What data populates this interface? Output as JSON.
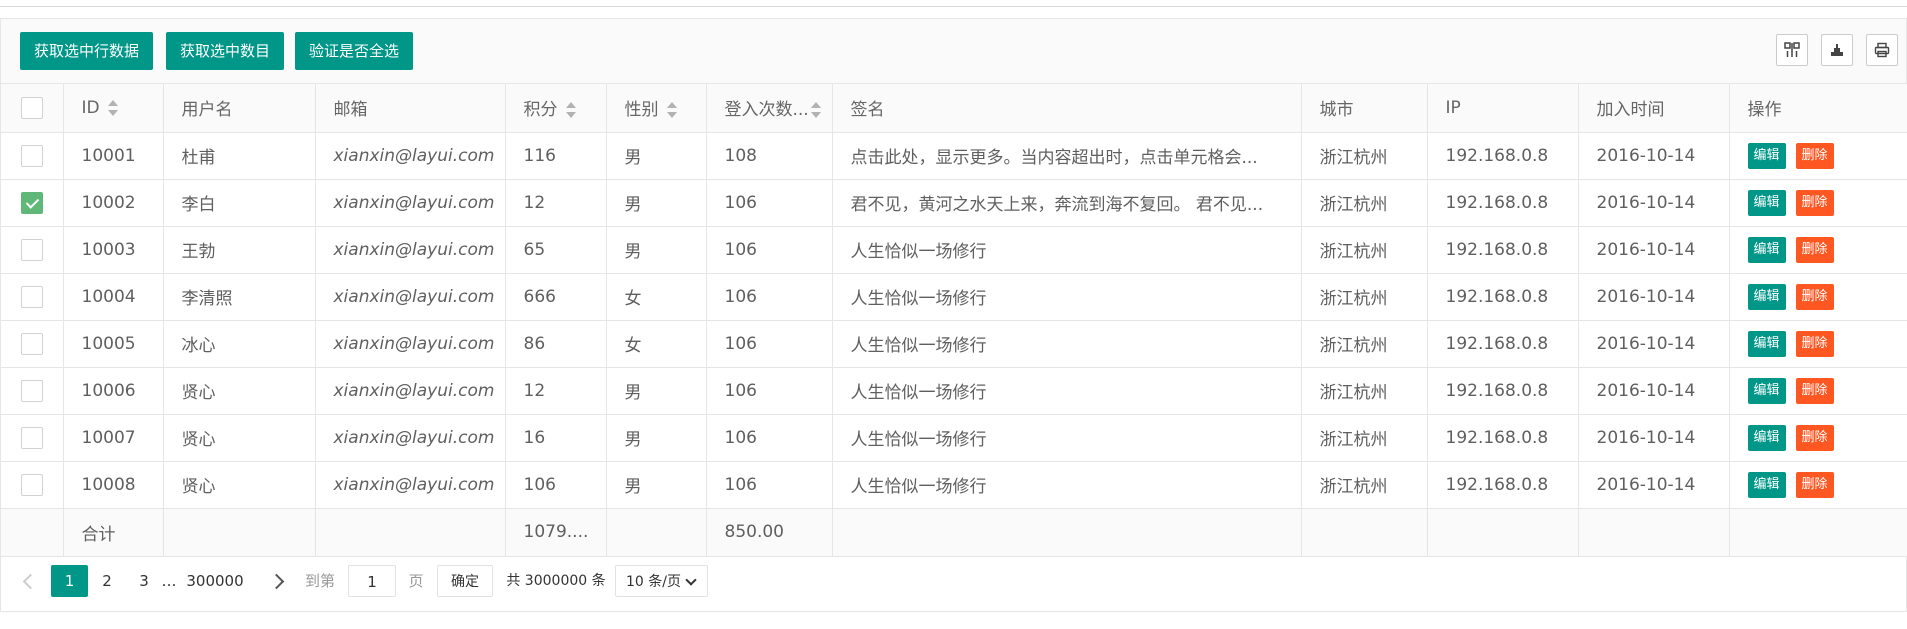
{
  "toolbar": {
    "buttons": [
      "获取选中行数据",
      "获取选中数目",
      "验证是否全选"
    ],
    "icons": [
      "columns-icon",
      "export-icon",
      "print-icon"
    ]
  },
  "table": {
    "headers": {
      "id": "ID",
      "username": "用户名",
      "email": "邮箱",
      "score": "积分",
      "sex": "性别",
      "logins": "登入次数...",
      "sign": "签名",
      "city": "城市",
      "ip": "IP",
      "joined": "加入时间",
      "actions": "操作"
    },
    "rows": [
      {
        "checked": false,
        "id": "10001",
        "username": "杜甫",
        "email": "xianxin@layui.com",
        "score": "116",
        "sex": "男",
        "logins": "108",
        "sign": "点击此处，显示更多。当内容超出时，点击单元格会...",
        "city": "浙江杭州",
        "ip": "192.168.0.8",
        "joined": "2016-10-14"
      },
      {
        "checked": true,
        "id": "10002",
        "username": "李白",
        "email": "xianxin@layui.com",
        "score": "12",
        "sex": "男",
        "logins": "106",
        "sign": "君不见，黄河之水天上来，奔流到海不复回。 君不见...",
        "city": "浙江杭州",
        "ip": "192.168.0.8",
        "joined": "2016-10-14"
      },
      {
        "checked": false,
        "id": "10003",
        "username": "王勃",
        "email": "xianxin@layui.com",
        "score": "65",
        "sex": "男",
        "logins": "106",
        "sign": "人生恰似一场修行",
        "city": "浙江杭州",
        "ip": "192.168.0.8",
        "joined": "2016-10-14"
      },
      {
        "checked": false,
        "id": "10004",
        "username": "李清照",
        "email": "xianxin@layui.com",
        "score": "666",
        "sex": "女",
        "logins": "106",
        "sign": "人生恰似一场修行",
        "city": "浙江杭州",
        "ip": "192.168.0.8",
        "joined": "2016-10-14"
      },
      {
        "checked": false,
        "id": "10005",
        "username": "冰心",
        "email": "xianxin@layui.com",
        "score": "86",
        "sex": "女",
        "logins": "106",
        "sign": "人生恰似一场修行",
        "city": "浙江杭州",
        "ip": "192.168.0.8",
        "joined": "2016-10-14"
      },
      {
        "checked": false,
        "id": "10006",
        "username": "贤心",
        "email": "xianxin@layui.com",
        "score": "12",
        "sex": "男",
        "logins": "106",
        "sign": "人生恰似一场修行",
        "city": "浙江杭州",
        "ip": "192.168.0.8",
        "joined": "2016-10-14"
      },
      {
        "checked": false,
        "id": "10007",
        "username": "贤心",
        "email": "xianxin@layui.com",
        "score": "16",
        "sex": "男",
        "logins": "106",
        "sign": "人生恰似一场修行",
        "city": "浙江杭州",
        "ip": "192.168.0.8",
        "joined": "2016-10-14"
      },
      {
        "checked": false,
        "id": "10008",
        "username": "贤心",
        "email": "xianxin@layui.com",
        "score": "106",
        "sex": "男",
        "logins": "106",
        "sign": "人生恰似一场修行",
        "city": "浙江杭州",
        "ip": "192.168.0.8",
        "joined": "2016-10-14"
      }
    ],
    "row_actions": {
      "edit": "编辑",
      "delete": "删除"
    },
    "total": {
      "label": "合计",
      "score": "1079....",
      "logins": "850.00"
    }
  },
  "pager": {
    "pages": [
      "1",
      "2",
      "3"
    ],
    "ellipsis": "…",
    "last_page": "300000",
    "current": "1",
    "goto_label": "到第",
    "goto_value": "1",
    "page_unit": "页",
    "confirm": "确定",
    "count_text": "共 3000000 条",
    "page_size": "10 条/页"
  },
  "colors": {
    "primary": "#009688",
    "danger": "#FF5722",
    "checked": "#5FB878"
  }
}
